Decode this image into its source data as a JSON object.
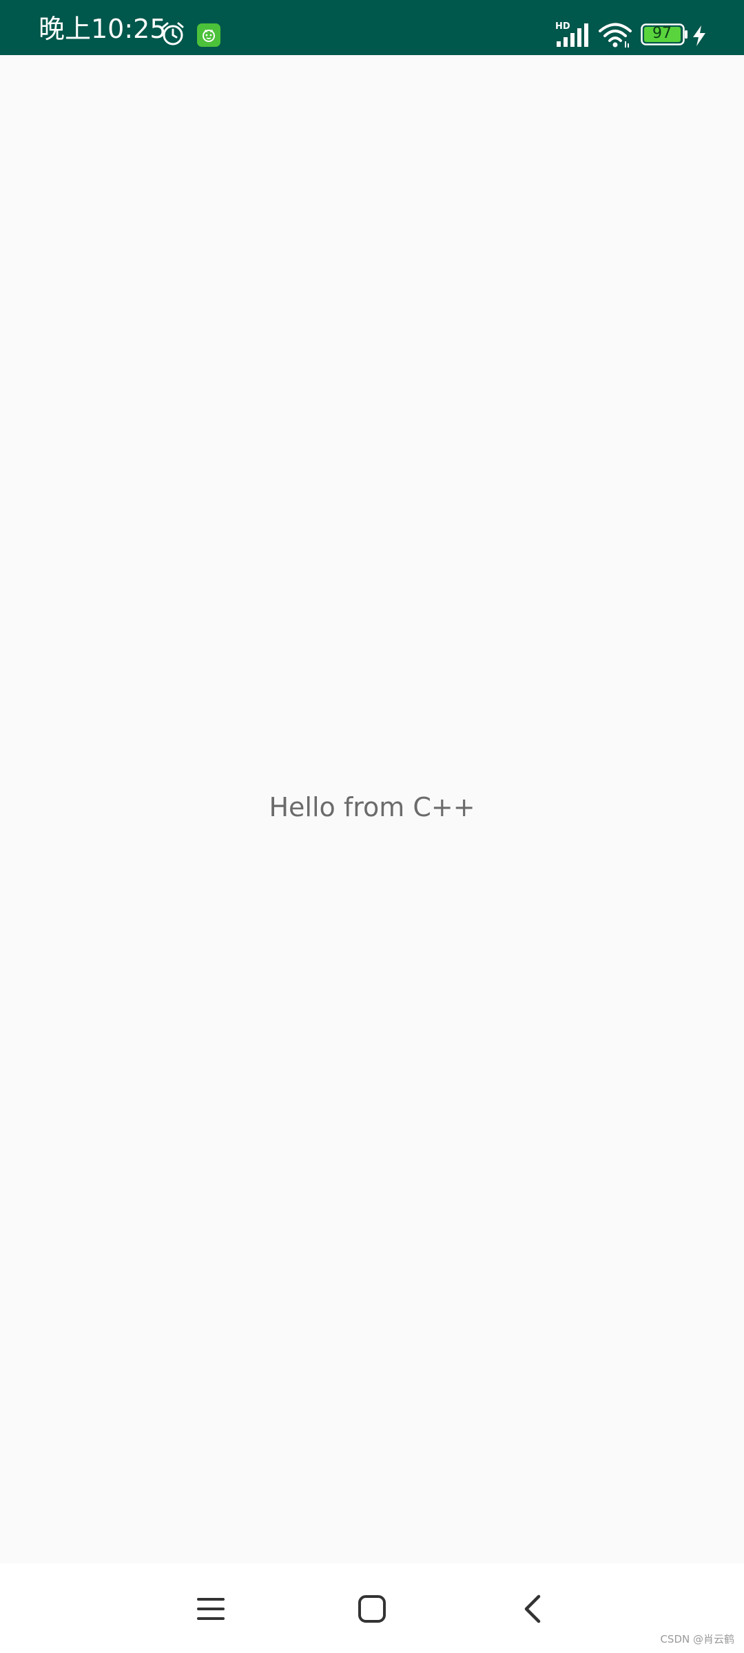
{
  "status_bar": {
    "time": "晚上10:25",
    "battery_level": "97",
    "background_color": "#00574b",
    "icons": [
      "alarm-icon",
      "app-notification-icon",
      "hd-signal-icon",
      "wifi-icon",
      "battery-icon",
      "charging-icon"
    ]
  },
  "main": {
    "message": "Hello from C++"
  },
  "nav_bar": {
    "buttons": [
      "menu-icon",
      "home-icon",
      "back-icon"
    ]
  },
  "watermark": "CSDN @肖云鹤"
}
